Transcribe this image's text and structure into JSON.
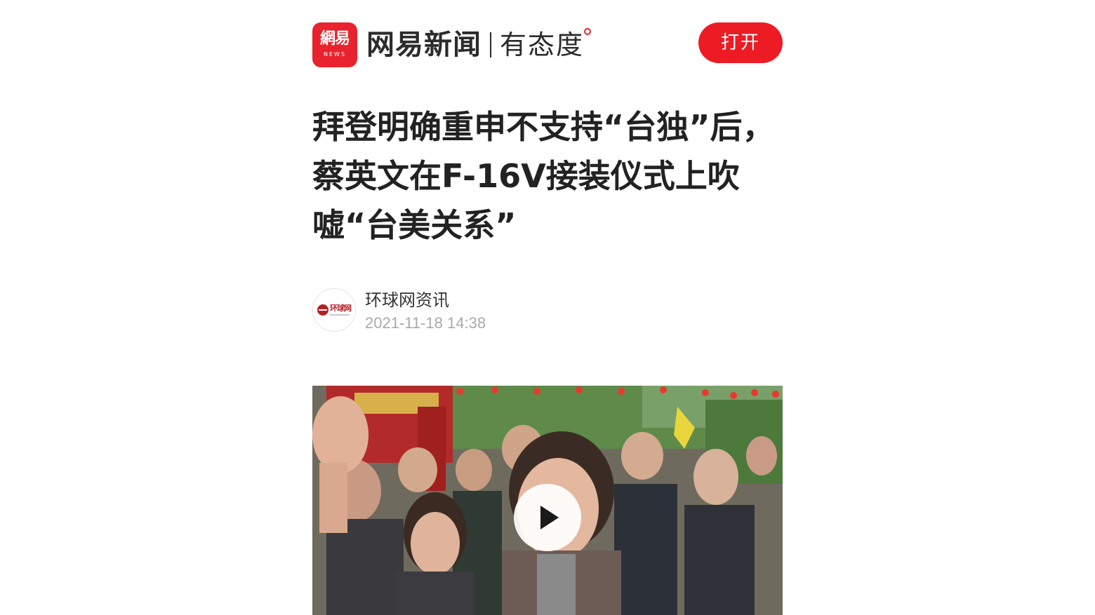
{
  "header": {
    "logo_main": "網易",
    "logo_sub": "NEWS",
    "brand_name": "网易新闻",
    "brand_slogan": "有态度",
    "open_button_label": "打开",
    "accent_color": "#ed1c24"
  },
  "article": {
    "title": "拜登明确重申不支持“台独”后，蔡英文在F-16V接装仪式上吹嘘“台美关系”"
  },
  "author": {
    "avatar_text": "环球网",
    "name": "环球网资讯",
    "published_at": "2021-11-18 14:38"
  },
  "video": {
    "play_icon": "play-icon"
  }
}
